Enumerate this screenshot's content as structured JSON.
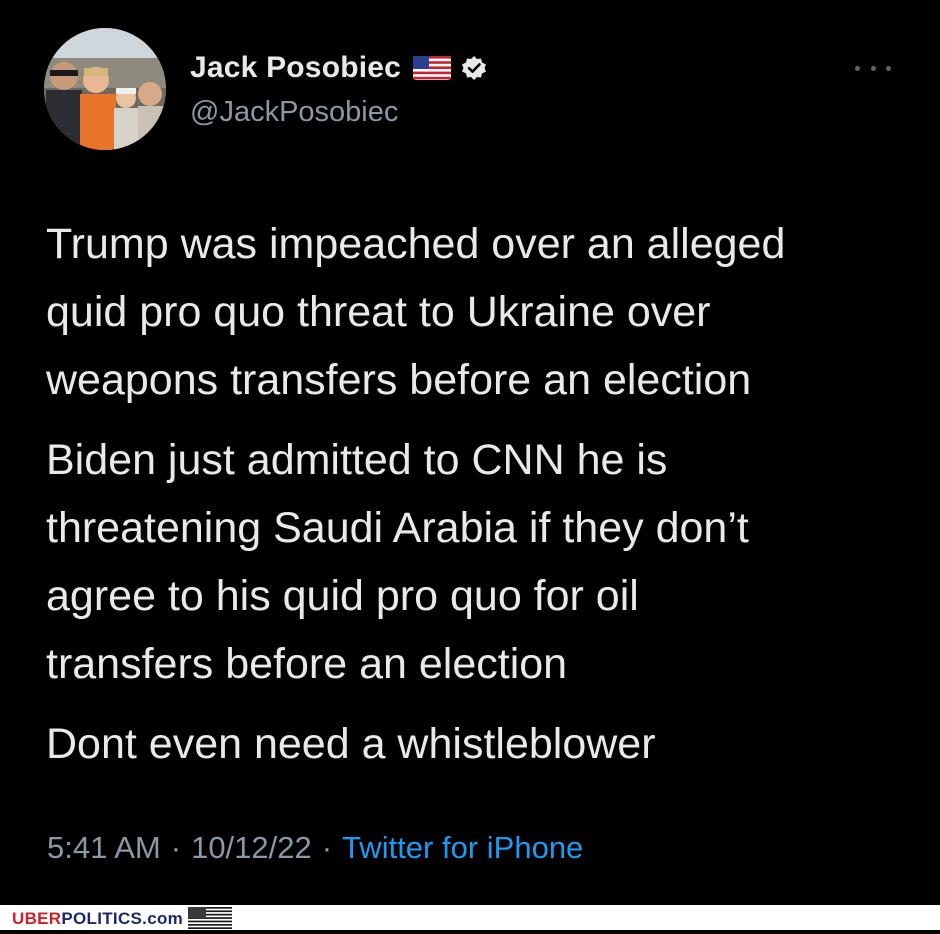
{
  "author": {
    "display_name": "Jack Posobiec",
    "handle": "@JackPosobiec",
    "flag_icon": "us-flag-icon",
    "verified_icon": "verified-badge-icon"
  },
  "tweet": {
    "paragraphs": [
      "Trump was impeached over an alleged\nquid pro quo threat to Ukraine over\nweapons transfers before an election",
      "Biden just admitted to CNN he  is\nthreatening Saudi Arabia if they don’t\nagree to his quid pro quo for oil\ntransfers before an election",
      "Dont even need a whistleblower"
    ]
  },
  "meta": {
    "time": "5:41 AM",
    "separator": "·",
    "date": "10/12/22",
    "source": "Twitter for iPhone"
  },
  "watermark": {
    "brand_part1": "UBER",
    "brand_part2": "POLITICS.com"
  },
  "colors": {
    "background": "#000000",
    "text": "#e7e9ea",
    "secondary": "#8b98a5",
    "link": "#1d9bf0",
    "brand_red": "#d21f26",
    "brand_navy": "#1c2a6b"
  }
}
